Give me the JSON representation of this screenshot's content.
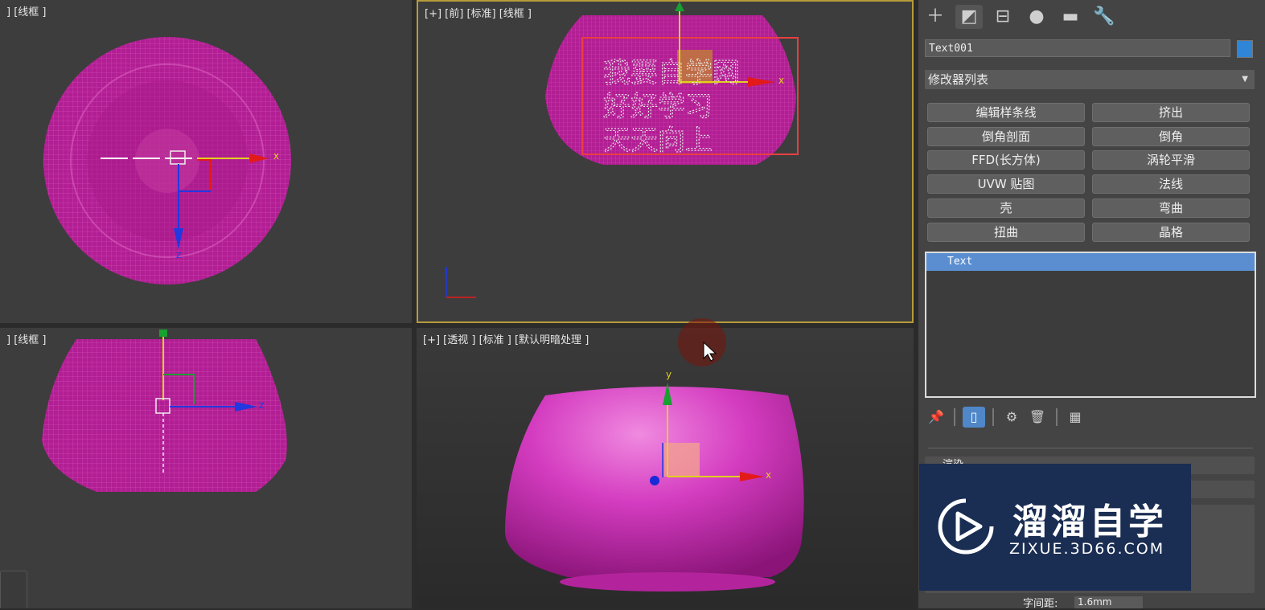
{
  "viewports": {
    "top_left": {
      "label": "] [线框 ]"
    },
    "top_right": {
      "label": "[+] [前] [标准] [线框 ]"
    },
    "bottom_left": {
      "label": "] [线框 ]"
    },
    "bottom_right": {
      "label": "[+] [透视 ] [标准 ] [默认明暗处理 ]"
    }
  },
  "axes": {
    "x": "x",
    "y": "y",
    "z": "z"
  },
  "text_object": {
    "lines": [
      "我要自学网",
      "好好学习",
      "天天向上"
    ]
  },
  "panel": {
    "tabs": [
      {
        "icon": "create-icon",
        "glyph": "＋"
      },
      {
        "icon": "modify-icon",
        "glyph": "◩"
      },
      {
        "icon": "hierarchy-icon",
        "glyph": "⊟"
      },
      {
        "icon": "motion-icon",
        "glyph": "●"
      },
      {
        "icon": "display-icon",
        "glyph": "▬"
      },
      {
        "icon": "utilities-icon",
        "glyph": "🔧"
      }
    ],
    "object_name": "Text001",
    "object_color": "#2f85d6",
    "modifier_list": "修改器列表",
    "modifier_buttons": [
      "编辑样条线",
      "挤出",
      "倒角剖面",
      "倒角",
      "FFD(长方体)",
      "涡轮平滑",
      "UVW 贴图",
      "法线",
      "壳",
      "弯曲",
      "扭曲",
      "晶格"
    ],
    "stack_items": [
      "Text"
    ],
    "rollouts": [
      "渲染",
      "",
      ""
    ],
    "char_spacing_label": "字间距:",
    "char_spacing_value": "1.6mm"
  },
  "watermark": {
    "title": "溜溜自学",
    "url": "ZIXUE.3D66.COM"
  },
  "colors": {
    "magenta": "#c0209a",
    "viewport_bg": "#3d3d3d",
    "panel_bg": "#444444",
    "active_border": "#b79a3a",
    "selection": "#5a8ed0"
  }
}
